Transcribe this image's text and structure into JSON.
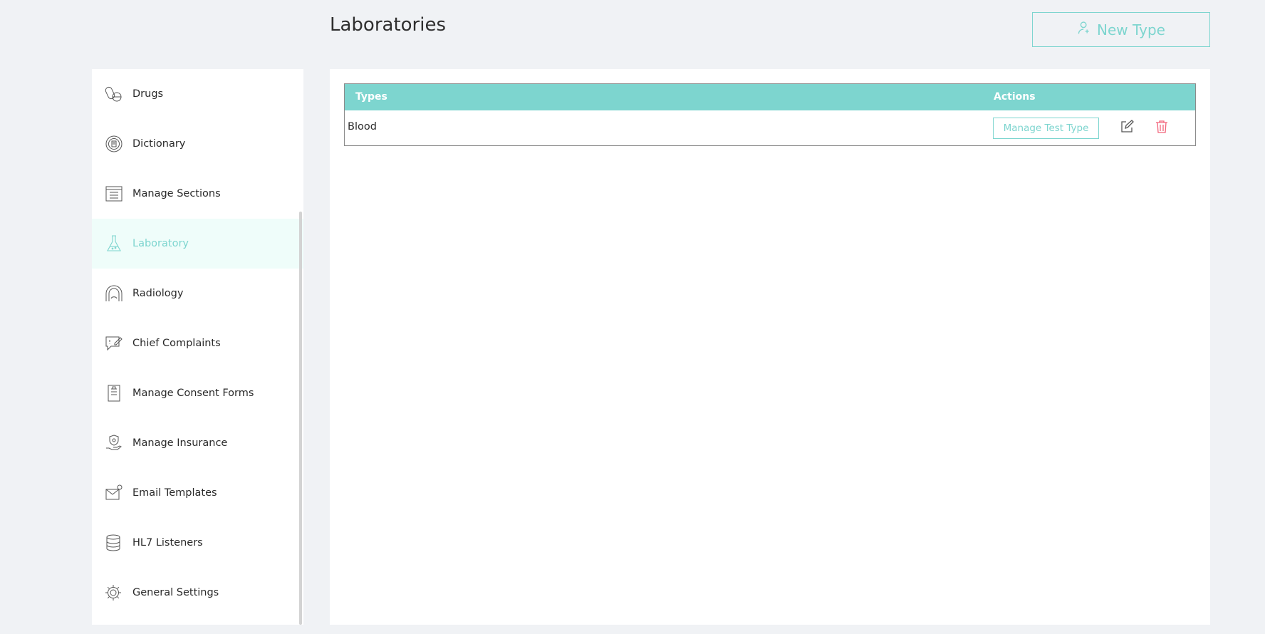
{
  "header": {
    "title": "Laboratories",
    "new_type_label": "New Type",
    "new_type_icon": "user-plus-icon"
  },
  "sidebar": {
    "items": [
      {
        "label": "Drugs",
        "icon": "pills-icon",
        "active": false
      },
      {
        "label": "Dictionary",
        "icon": "dictionary-icon",
        "active": false
      },
      {
        "label": "Manage Sections",
        "icon": "sections-icon",
        "active": false
      },
      {
        "label": "Laboratory",
        "icon": "flask-icon",
        "active": true
      },
      {
        "label": "Radiology",
        "icon": "radiology-icon",
        "active": false
      },
      {
        "label": "Chief Complaints",
        "icon": "chat-edit-icon",
        "active": false
      },
      {
        "label": "Manage Consent Forms",
        "icon": "consent-form-icon",
        "active": false
      },
      {
        "label": "Manage Insurance",
        "icon": "insurance-hand-icon",
        "active": false
      },
      {
        "label": "Email Templates",
        "icon": "email-template-icon",
        "active": false
      },
      {
        "label": "HL7 Listeners",
        "icon": "database-icon",
        "active": false
      },
      {
        "label": "General Settings",
        "icon": "gear-icon",
        "active": false
      }
    ]
  },
  "table": {
    "columns": [
      "Types",
      "Actions"
    ],
    "rows": [
      {
        "type": "Blood",
        "manage_label": "Manage Test Type"
      }
    ]
  },
  "colors": {
    "accent": "#7dd5cf",
    "active_bg": "#effdfa",
    "delete": "#f2637a",
    "background": "#f0f2f5"
  }
}
